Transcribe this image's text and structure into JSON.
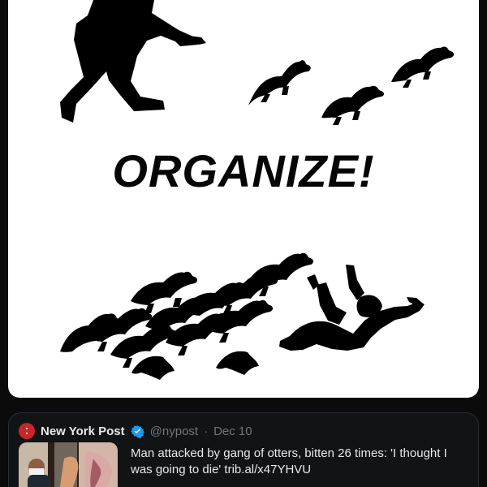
{
  "poster": {
    "title": "ORGANIZE!"
  },
  "tweet": {
    "source_logo_icon": "new-york-post-logo",
    "verified_icon": "verified-badge-icon",
    "author_name": "New York Post",
    "handle": "@nypost",
    "separator": "·",
    "date": "Dec 10",
    "headline": "Man attacked by gang of otters, bitten 26 times: 'I thought I was going to die' trib.al/x47YHVU"
  },
  "colors": {
    "page_background": "#0b0b0b",
    "poster_background": "#ffffff",
    "silhouette": "#000000",
    "card_background": "#111315",
    "card_border": "#2a2f34",
    "primary_text": "#e7e9ea",
    "secondary_text": "#71767b",
    "verified_badge": "#1d9bf0",
    "nypost_red": "#c9252c"
  }
}
